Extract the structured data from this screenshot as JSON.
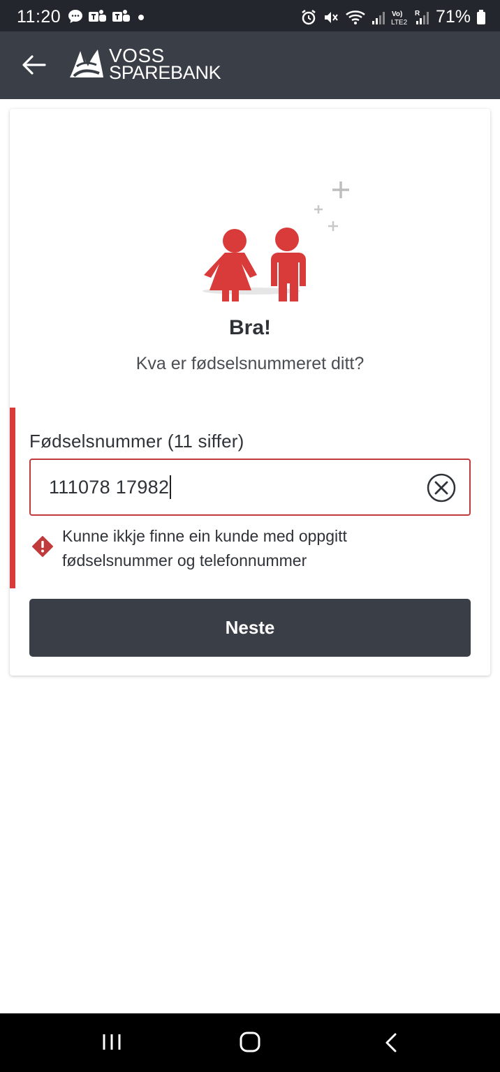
{
  "status_bar": {
    "time": "11:20",
    "battery": "71%",
    "notification_icons": [
      "chat-bubble-icon",
      "teams-icon",
      "teams-icon",
      "dot-icon"
    ],
    "system_icons": [
      "alarm-icon",
      "mute-icon",
      "wifi-icon",
      "signal-icon",
      "volte-icon",
      "signal-roaming-icon",
      "battery-icon"
    ]
  },
  "app_bar": {
    "back_icon": "arrow-left-icon",
    "logo_line1": "VOSS",
    "logo_line2": "SPAREBANK"
  },
  "card": {
    "illustration": "two-people-icon",
    "title": "Bra!",
    "subtitle": "Kva er fødselsnummeret ditt?",
    "field": {
      "label": "Fødselsnummer (11 siffer)",
      "value": "111078 17982",
      "clear_icon": "clear-circle-icon"
    },
    "error_message": "Kunne ikkje finne ein kunde med oppgitt fødselsnummer og telefonnummer",
    "next_button": "Neste"
  },
  "colors": {
    "accent_red": "#d93b3b",
    "dark": "#3a3e46"
  },
  "nav_bar": {
    "icons": [
      "recents-icon",
      "home-icon",
      "back-icon"
    ]
  }
}
